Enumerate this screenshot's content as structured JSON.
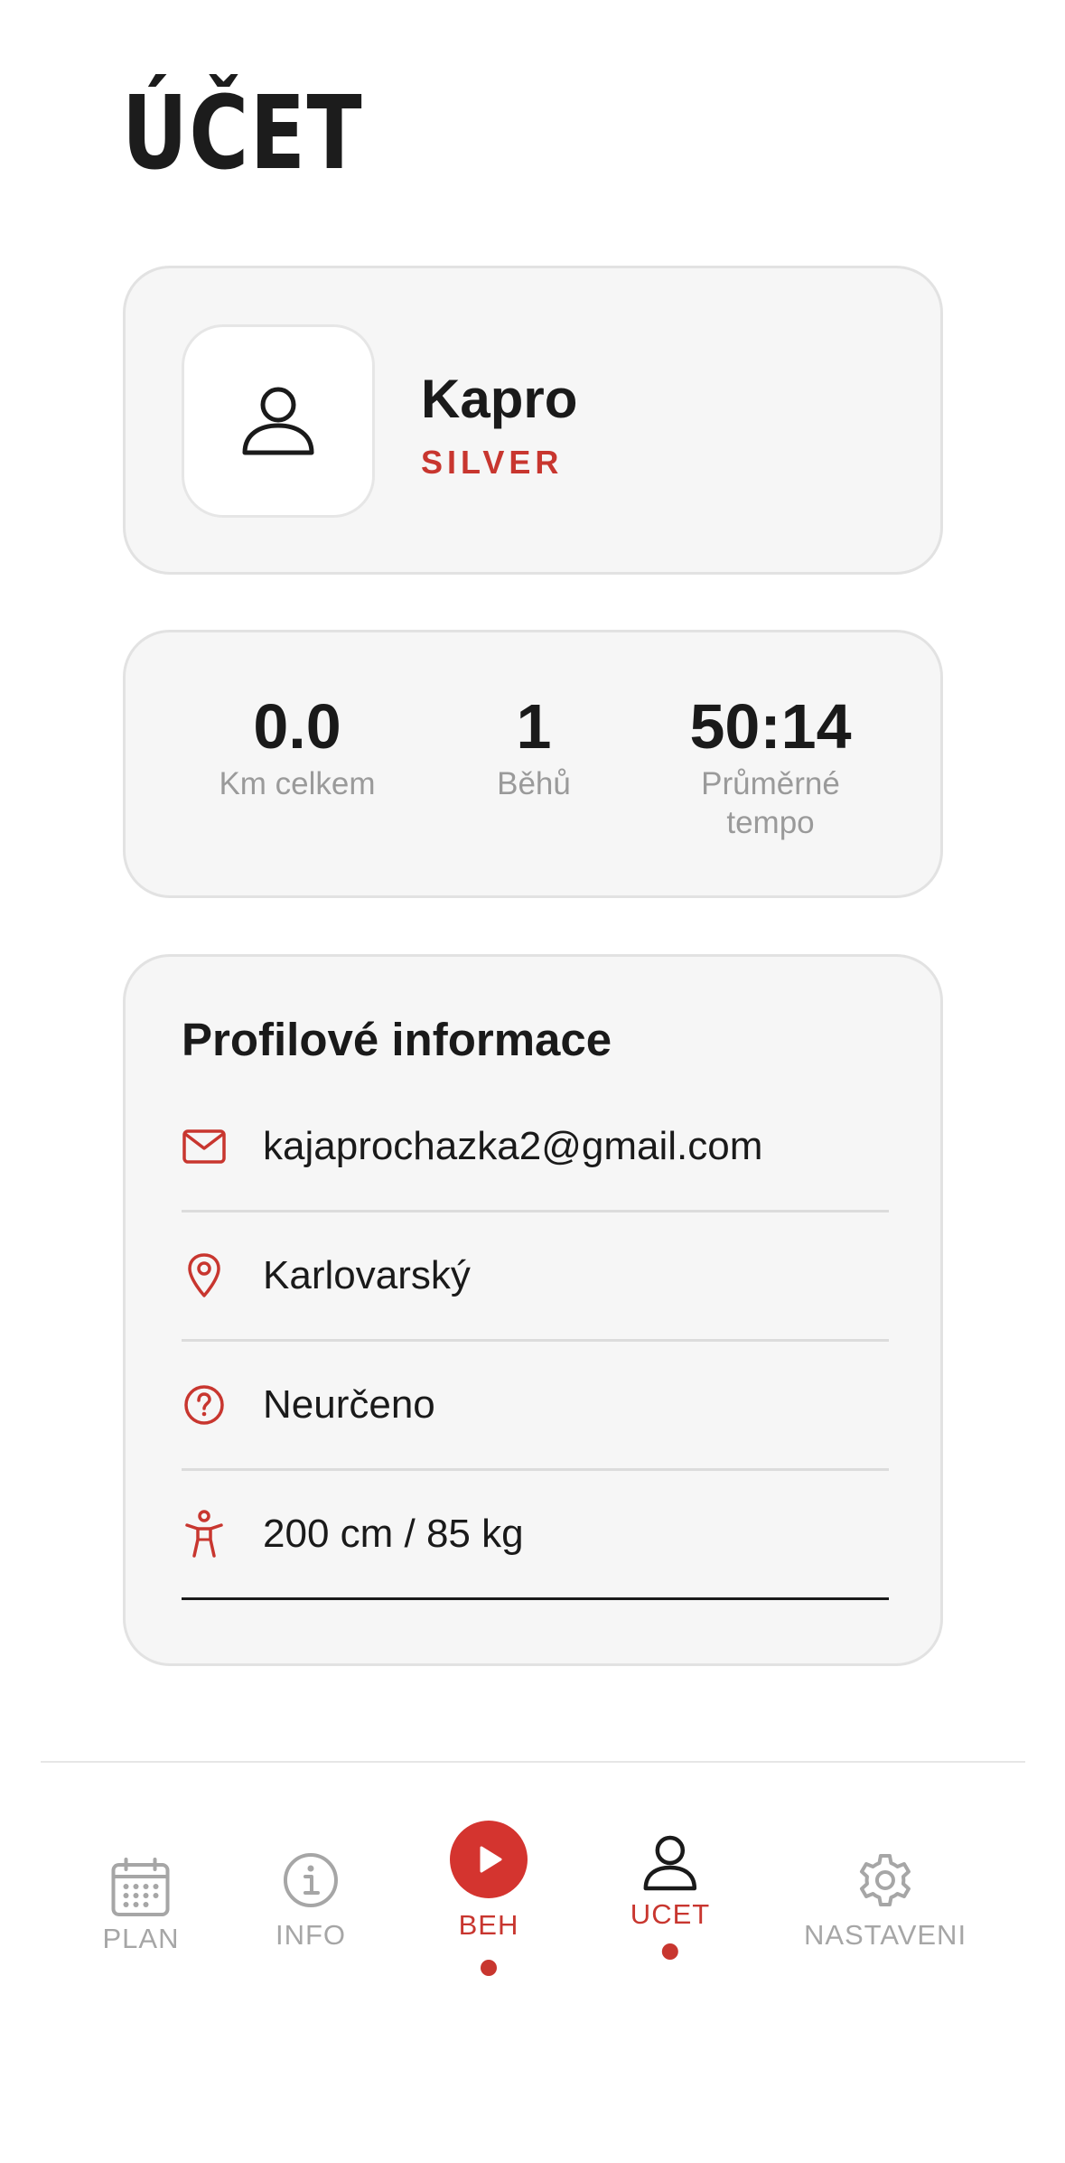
{
  "page": {
    "title": "ÚČET"
  },
  "profile": {
    "name": "Kapro",
    "tier": "SILVER",
    "avatar_icon": "user-icon"
  },
  "stats": [
    {
      "value": "0.0",
      "label": "Km celkem"
    },
    {
      "value": "1",
      "label": "Běhů"
    },
    {
      "value": "50:14",
      "label": "Průměrné tempo"
    }
  ],
  "profile_info": {
    "title": "Profilové informace",
    "rows": [
      {
        "icon": "mail-icon",
        "text": "kajaprochazka2@gmail.com"
      },
      {
        "icon": "location-pin-icon",
        "text": "Karlovarský"
      },
      {
        "icon": "question-icon",
        "text": "Neurčeno"
      },
      {
        "icon": "body-icon",
        "text": "200 cm / 85 kg"
      }
    ]
  },
  "nav": {
    "items": [
      {
        "label": "PLAN",
        "icon": "calendar-icon",
        "active": false
      },
      {
        "label": "INFO",
        "icon": "info-icon",
        "active": false
      },
      {
        "label": "BEH",
        "icon": "play-icon",
        "active": true
      },
      {
        "label": "UCET",
        "icon": "user-icon",
        "active": true
      },
      {
        "label": "NASTAVENI",
        "icon": "gear-icon",
        "active": false
      }
    ]
  },
  "colors": {
    "accent": "#c8362f",
    "card_bg": "#f6f6f6",
    "inactive": "#a6a6a6"
  }
}
